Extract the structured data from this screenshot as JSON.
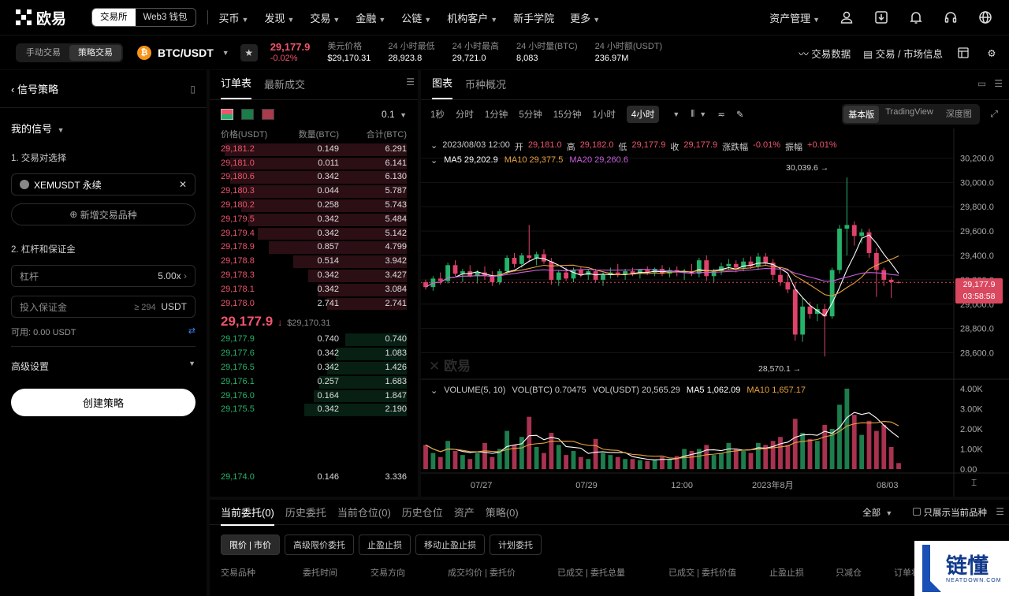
{
  "brand": {
    "name": "欧易"
  },
  "top": {
    "seg": [
      "交易所",
      "Web3 钱包"
    ],
    "nav": [
      "买币",
      "发现",
      "交易",
      "金融",
      "公链",
      "机构客户",
      "新手学院",
      "更多"
    ],
    "nav_caret": [
      true,
      true,
      true,
      true,
      true,
      true,
      false,
      true
    ],
    "asset": "资产管理"
  },
  "sub": {
    "modes": [
      "手动交易",
      "策略交易"
    ],
    "pair": "BTC/USDT",
    "last_price": "29,177.9",
    "change": "-0.02%",
    "stats": [
      {
        "k": "美元价格",
        "v": "$29,170.31"
      },
      {
        "k": "24 小时最低",
        "v": "28,923.8"
      },
      {
        "k": "24 小时最高",
        "v": "29,721.0"
      },
      {
        "k": "24 小时量(BTC)",
        "v": "8,083"
      },
      {
        "k": "24 小时额(USDT)",
        "v": "236.97M"
      }
    ],
    "right": [
      "交易数据",
      "交易 / 市场信息"
    ]
  },
  "strategy": {
    "title": "信号策略",
    "my_signal": "我的信号",
    "sec1": "1. 交易对选择",
    "pair_value": "XEMUSDT 永续",
    "add_pair": "新增交易品种",
    "sec2": "2. 杠杆和保证金",
    "lev_label": "杠杆",
    "lev_value": "5.00x",
    "margin_placeholder": "投入保证金",
    "margin_min": "≥ 294",
    "margin_unit": "USDT",
    "avail": "可用: 0.00 USDT",
    "advanced": "高级设置",
    "create": "创建策略"
  },
  "orderbook": {
    "tabs": [
      "订单表",
      "最新成交"
    ],
    "precision": "0.1",
    "headers": [
      "价格(USDT)",
      "数量(BTC)",
      "合计(BTC)"
    ],
    "asks": [
      [
        "29,181.2",
        "0.149",
        "6.291",
        0.98
      ],
      [
        "29,181.0",
        "0.011",
        "6.141",
        0.95
      ],
      [
        "29,180.6",
        "0.342",
        "6.130",
        0.95
      ],
      [
        "29,180.3",
        "0.044",
        "5.787",
        0.9
      ],
      [
        "29,180.2",
        "0.258",
        "5.743",
        0.89
      ],
      [
        "29,179.5",
        "0.342",
        "5.484",
        0.85
      ],
      [
        "29,179.4",
        "0.342",
        "5.142",
        0.8
      ],
      [
        "29,178.9",
        "0.857",
        "4.799",
        0.74
      ],
      [
        "29,178.8",
        "0.514",
        "3.942",
        0.61
      ],
      [
        "29,178.3",
        "0.342",
        "3.427",
        0.53
      ],
      [
        "29,178.1",
        "0.342",
        "3.084",
        0.48
      ],
      [
        "29,178.0",
        "2.741",
        "2.741",
        0.43
      ]
    ],
    "mid_price": "29,177.9",
    "mid_usd": "$29,170.31",
    "bids": [
      [
        "29,177.9",
        "0.740",
        "0.740",
        0.33
      ],
      [
        "29,177.6",
        "0.342",
        "1.083",
        0.38
      ],
      [
        "29,176.5",
        "0.342",
        "1.426",
        0.43
      ],
      [
        "29,176.1",
        "0.257",
        "1.683",
        0.47
      ],
      [
        "29,176.0",
        "0.164",
        "1.847",
        0.5
      ],
      [
        "29,175.5",
        "0.342",
        "2.190",
        0.55
      ]
    ],
    "bottom_row": [
      "29,174.0",
      "0.146",
      "3.336"
    ]
  },
  "chart_panel": {
    "tabs": [
      "图表",
      "币种概况"
    ],
    "intervals": [
      "1秒",
      "分时",
      "1分钟",
      "5分钟",
      "15分钟",
      "1小时",
      "4小时"
    ],
    "active_interval": "4小时",
    "views": [
      "基本版",
      "TradingView",
      "深度图"
    ],
    "ohlc_line": {
      "date": "2023/08/03 12:00",
      "o_k": "开",
      "o": "29,181.0",
      "h_k": "高",
      "h": "29,182.0",
      "l_k": "低",
      "l": "29,177.9",
      "c_k": "收",
      "c": "29,177.9",
      "chg_k": "涨跌幅",
      "chg": "-0.01%",
      "amp_k": "振幅",
      "amp": "+0.01%"
    },
    "ma_line": {
      "ma5": "MA5  29,202.9",
      "ma10": "MA10  29,377.5",
      "ma20": "MA20  29,260.6"
    },
    "vol_line": {
      "a": "VOLUME(5, 10)",
      "b": "VOL(BTC)  0.70475",
      "c": "VOL(USDT)  20,565.29",
      "d": "MA5  1,062.09",
      "e": "MA10  1,657.17"
    },
    "price_ticks": [
      "30,200.0",
      "30,000.0",
      "29,800.0",
      "29,600.0",
      "29,400.0",
      "29,200.0",
      "29,000.0",
      "28,800.0",
      "28,600.0"
    ],
    "vol_ticks": [
      "4.00K",
      "3.00K",
      "2.00K",
      "1.00K",
      "0.00"
    ],
    "x_ticks": [
      "07/27",
      "07/29",
      "12:00",
      "2023年8月",
      "08/03"
    ],
    "current_price": "29,177.9",
    "countdown": "03:58:58",
    "high_note": "30,039.6",
    "low_note": "28,570.1",
    "watermark": "欧易"
  },
  "bottom": {
    "tabs": [
      "当前委托(0)",
      "历史委托",
      "当前仓位(0)",
      "历史仓位",
      "资产",
      "策略(0)"
    ],
    "filter": "全部",
    "only_current": "只展示当前品种",
    "pills": [
      "限价 | 市价",
      "高级限价委托",
      "止盈止损",
      "移动止盈止损",
      "计划委托"
    ],
    "cols": [
      "交易品种",
      "委托时间",
      "交易方向",
      "成交均价 | 委托价",
      "已成交 | 委托总量",
      "已成交 | 委托价值",
      "止盈止损",
      "只减仓",
      "订单状"
    ]
  },
  "corner_logo": {
    "text": "链懂",
    "sub": "NEATDOWN.COM"
  },
  "chart_data": {
    "type": "candlestick",
    "ylim": [
      28500,
      30300
    ],
    "vol_ylim": [
      0,
      4000
    ],
    "candles": [
      [
        29180,
        29200,
        29120,
        29140,
        1200
      ],
      [
        29140,
        29230,
        29110,
        29210,
        800
      ],
      [
        29210,
        29260,
        29160,
        29190,
        600
      ],
      [
        29190,
        29340,
        29170,
        29320,
        1400
      ],
      [
        29320,
        29360,
        29230,
        29250,
        900
      ],
      [
        29250,
        29290,
        29180,
        29270,
        700
      ],
      [
        29270,
        29320,
        29220,
        29230,
        500
      ],
      [
        29230,
        29280,
        29170,
        29260,
        800
      ],
      [
        29260,
        29310,
        29200,
        29230,
        1300
      ],
      [
        29230,
        29270,
        29150,
        29180,
        600
      ],
      [
        29180,
        29290,
        29160,
        29270,
        1000
      ],
      [
        29270,
        29400,
        29240,
        29380,
        1900
      ],
      [
        29380,
        29420,
        29300,
        29330,
        1200
      ],
      [
        29330,
        29420,
        29300,
        29400,
        1600
      ],
      [
        29400,
        29650,
        29350,
        29380,
        2600
      ],
      [
        29380,
        29430,
        29320,
        29410,
        1100
      ],
      [
        29410,
        29450,
        29330,
        29350,
        800
      ],
      [
        29350,
        29380,
        29160,
        29200,
        1800
      ],
      [
        29200,
        29280,
        29150,
        29260,
        1200
      ],
      [
        29260,
        29300,
        29190,
        29210,
        700
      ],
      [
        29210,
        29300,
        29180,
        29280,
        900
      ],
      [
        29280,
        29310,
        29220,
        29240,
        600
      ],
      [
        29240,
        29290,
        29200,
        29270,
        500
      ],
      [
        29270,
        29290,
        29180,
        29200,
        1500
      ],
      [
        29200,
        29260,
        29150,
        29240,
        800
      ],
      [
        29240,
        29300,
        29210,
        29260,
        700
      ],
      [
        29260,
        29330,
        29220,
        29240,
        600
      ],
      [
        29240,
        29290,
        29200,
        29270,
        500
      ],
      [
        29270,
        29300,
        29230,
        29250,
        500
      ],
      [
        29250,
        29290,
        29210,
        29280,
        450
      ],
      [
        29280,
        29310,
        29240,
        29260,
        400
      ],
      [
        29260,
        29300,
        29230,
        29290,
        450
      ],
      [
        29290,
        29320,
        29230,
        29250,
        600
      ],
      [
        29250,
        29300,
        29220,
        29280,
        500
      ],
      [
        29280,
        29310,
        29230,
        29260,
        650
      ],
      [
        29260,
        29290,
        29200,
        29270,
        1000
      ],
      [
        29270,
        29330,
        29230,
        29250,
        900
      ],
      [
        29250,
        29380,
        29220,
        29360,
        1000
      ],
      [
        29360,
        29400,
        29190,
        29230,
        1200
      ],
      [
        29230,
        29290,
        29180,
        29270,
        700
      ],
      [
        29270,
        29340,
        29240,
        29310,
        800
      ],
      [
        29310,
        29370,
        29280,
        29330,
        1300
      ],
      [
        29330,
        29360,
        29260,
        29300,
        1000
      ],
      [
        29300,
        29380,
        29270,
        29350,
        900
      ],
      [
        29350,
        29390,
        29290,
        29310,
        800
      ],
      [
        29310,
        29420,
        29280,
        29390,
        1300
      ],
      [
        29390,
        29420,
        29320,
        29340,
        1200
      ],
      [
        29340,
        29370,
        29200,
        29240,
        1400
      ],
      [
        29240,
        29300,
        29150,
        29180,
        1600
      ],
      [
        29180,
        29240,
        29090,
        29120,
        1200
      ],
      [
        29120,
        29180,
        28700,
        28750,
        2500
      ],
      [
        28750,
        29050,
        28690,
        28980,
        1800
      ],
      [
        28980,
        29020,
        28880,
        28920,
        1500
      ],
      [
        28920,
        29000,
        28860,
        28960,
        1400
      ],
      [
        28960,
        29000,
        28570,
        28900,
        2200
      ],
      [
        28900,
        29300,
        28880,
        29280,
        2000
      ],
      [
        29280,
        29650,
        29250,
        29620,
        3200
      ],
      [
        29620,
        30040,
        29400,
        29650,
        4000
      ],
      [
        29650,
        29680,
        29480,
        29560,
        2700
      ],
      [
        29560,
        29620,
        29500,
        29590,
        1700
      ],
      [
        29590,
        29620,
        29380,
        29420,
        2400
      ],
      [
        29420,
        29460,
        29060,
        29280,
        1900
      ],
      [
        29280,
        29300,
        29150,
        29200,
        2200
      ],
      [
        29200,
        29220,
        29050,
        29180,
        1100
      ],
      [
        29180,
        29190,
        29170,
        29178,
        300
      ]
    ]
  }
}
